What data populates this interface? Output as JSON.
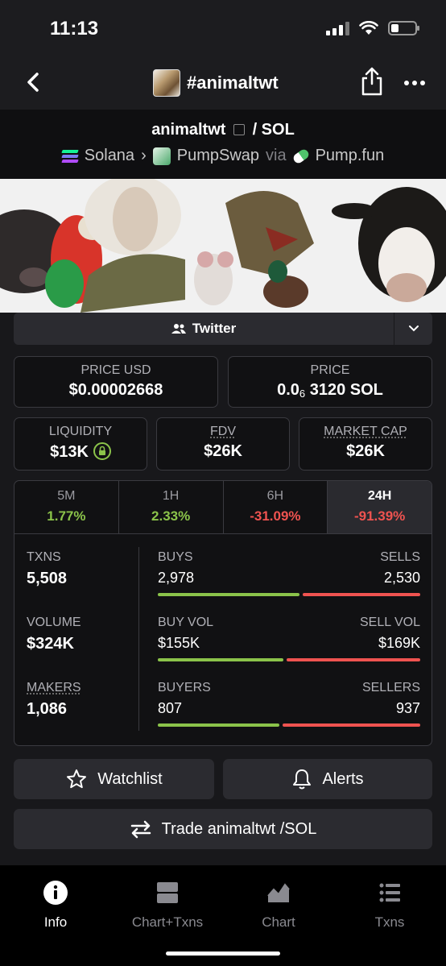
{
  "status": {
    "time": "11:13"
  },
  "nav": {
    "title": "#animaltwt"
  },
  "pair": {
    "base": "animaltwt",
    "quote": "/ SOL",
    "chain": "Solana",
    "dex": "PumpSwap",
    "via": "via",
    "launchpad": "Pump.fun"
  },
  "socials": {
    "twitter": "Twitter"
  },
  "prices": {
    "usd_label": "PRICE USD",
    "usd_value": "$0.00002668",
    "native_label": "PRICE",
    "native_prefix": "0.0",
    "native_sub": "6",
    "native_suffix": "3120 SOL"
  },
  "metrics": {
    "liquidity_label": "LIQUIDITY",
    "liquidity_value": "$13K",
    "fdv_label": "FDV",
    "fdv_value": "$26K",
    "mcap_label": "MARKET CAP",
    "mcap_value": "$26K"
  },
  "periods": [
    {
      "label": "5M",
      "change": "1.77%"
    },
    {
      "label": "1H",
      "change": "2.33%"
    },
    {
      "label": "6H",
      "change": "-31.09%"
    },
    {
      "label": "24H",
      "change": "-91.39%"
    }
  ],
  "stats": {
    "txns_label": "TXNS",
    "txns_value": "5,508",
    "volume_label": "VOLUME",
    "volume_value": "$324K",
    "makers_label": "MAKERS",
    "makers_value": "1,086",
    "buys_label": "BUYS",
    "buys_value": "2,978",
    "sells_label": "SELLS",
    "sells_value": "2,530",
    "buyvol_label": "BUY VOL",
    "buyvol_value": "$155K",
    "sellvol_label": "SELL VOL",
    "sellvol_value": "$169K",
    "buyers_label": "BUYERS",
    "buyers_value": "807",
    "sellers_label": "SELLERS",
    "sellers_value": "937",
    "buys_share": 0.541,
    "buyvol_share": 0.478,
    "buyers_share": 0.463
  },
  "actions": {
    "watchlist": "Watchlist",
    "alerts": "Alerts",
    "trade": "Trade animaltwt /SOL"
  },
  "tabs": [
    {
      "label": "Info"
    },
    {
      "label": "Chart+Txns"
    },
    {
      "label": "Chart"
    },
    {
      "label": "Txns"
    }
  ],
  "colors": {
    "positive": "#8bc34a",
    "negative": "#ef5350",
    "background": "#18181b"
  }
}
